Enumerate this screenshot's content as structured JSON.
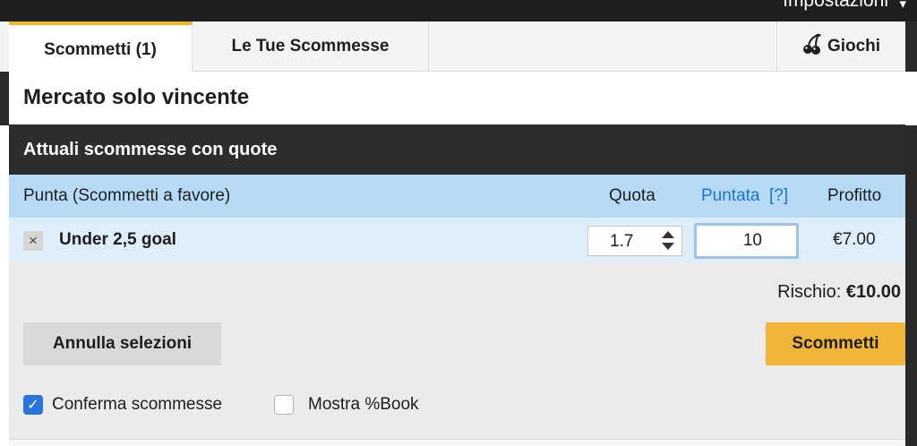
{
  "header": {
    "settings_label": "Impostazioni"
  },
  "tabs": {
    "betslip": "Scommetti (1)",
    "my_bets": "Le Tue Scommesse",
    "games": "Giochi"
  },
  "market_title": "Mercato solo vincente",
  "section_title": "Attuali scommesse con quote",
  "columns": {
    "side": "Punta (Scommetti a favore)",
    "odds": "Quota",
    "stake": "Puntata",
    "stake_help": "[?]",
    "profit": "Profitto"
  },
  "bet": {
    "remove_symbol": "×",
    "selection": "Under 2,5 goal",
    "odds": "1.7",
    "stake": "10",
    "profit": "€7.00"
  },
  "risk": {
    "label": "Rischio:",
    "value": "€10.00"
  },
  "buttons": {
    "cancel": "Annulla selezioni",
    "place_bet": "Scommetti"
  },
  "options": {
    "confirm_bets": {
      "label": "Conferma scommesse",
      "checked": true
    },
    "show_book": {
      "label": "Mostra %Book",
      "checked": false
    }
  },
  "colors": {
    "accent": "#f1b638",
    "header_dark": "#2d2d2d",
    "column_header": "#b7dbf7",
    "link_blue": "#1a73d9",
    "checkbox_blue": "#2a75dc"
  }
}
